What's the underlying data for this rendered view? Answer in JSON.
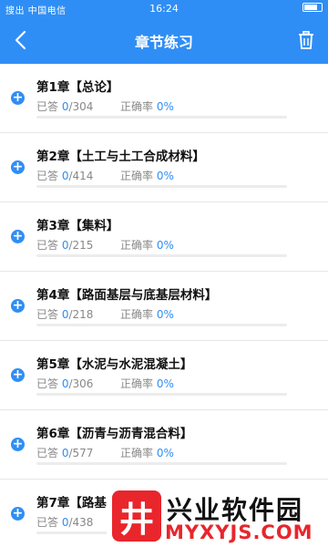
{
  "status_bar": {
    "carrier": "搜出 中国电信",
    "time": "16:24",
    "battery_icon": "battery-icon"
  },
  "header": {
    "title": "章节练习",
    "back_icon": "back-icon",
    "trash_icon": "trash-icon"
  },
  "labels": {
    "answered_prefix": "已答",
    "accuracy_label": "正确率"
  },
  "chapters": [
    {
      "title": "第1章【总论】",
      "answered": "0",
      "total": "/304",
      "accuracy": "0%",
      "progress": 0
    },
    {
      "title": "第2章【土工与土工合成材料】",
      "answered": "0",
      "total": "/414",
      "accuracy": "0%",
      "progress": 0
    },
    {
      "title": "第3章【集料】",
      "answered": "0",
      "total": "/215",
      "accuracy": "0%",
      "progress": 0
    },
    {
      "title": "第4章【路面基层与底基层材料】",
      "answered": "0",
      "total": "/218",
      "accuracy": "0%",
      "progress": 0
    },
    {
      "title": "第5章【水泥与水泥混凝土】",
      "answered": "0",
      "total": "/306",
      "accuracy": "0%",
      "progress": 0
    },
    {
      "title": "第6章【沥青与沥青混合料】",
      "answered": "0",
      "total": "/577",
      "accuracy": "0%",
      "progress": 0
    },
    {
      "title": "第7章【路基",
      "answered": "0",
      "total": "/438",
      "accuracy": "",
      "progress": 0
    }
  ],
  "watermark": {
    "logo_char": "井",
    "name": "兴业软件园",
    "url": "MYXYJS.COM"
  },
  "colors": {
    "accent": "#2f8ef5",
    "watermark_red": "#e8262c"
  }
}
